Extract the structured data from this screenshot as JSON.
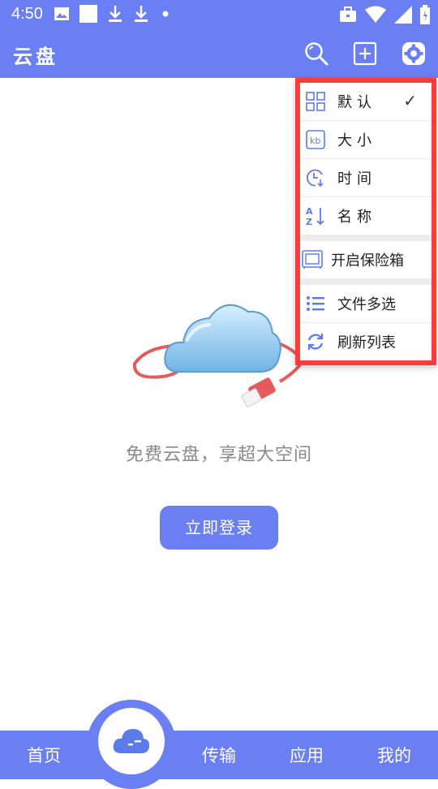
{
  "status_bar": {
    "time": "4:50",
    "icons_left": [
      "image-icon",
      "square-icon",
      "download-icon",
      "download-icon",
      "dot-icon"
    ],
    "icons_right": [
      "briefcase-icon",
      "wifi-icon",
      "signal-icon",
      "battery-icon"
    ]
  },
  "app_bar": {
    "title": "云盘",
    "actions": [
      "search-icon",
      "add-icon",
      "settings-icon"
    ]
  },
  "main": {
    "empty_text": "免费云盘，享超大空间",
    "login_button": "立即登录"
  },
  "menu": {
    "items": [
      {
        "label": "默认",
        "icon": "grid-icon",
        "checked": true
      },
      {
        "label": "大小",
        "icon": "kb-icon"
      },
      {
        "label": "时间",
        "icon": "clock-icon"
      },
      {
        "label": "名称",
        "icon": "sort-az-icon"
      },
      {
        "label": "开启保险箱",
        "icon": "safe-icon"
      },
      {
        "label": "文件多选",
        "icon": "list-icon"
      },
      {
        "label": "刷新列表",
        "icon": "refresh-icon"
      }
    ],
    "check_mark": "✓"
  },
  "bottom_nav": {
    "items": [
      {
        "label": "首页"
      },
      {
        "label": "传输"
      },
      {
        "label": "应用"
      },
      {
        "label": "我的"
      }
    ]
  },
  "colors": {
    "primary": "#6b7ff5",
    "highlight_border": "#ff3b3b",
    "icon_blue": "#5b7bea"
  }
}
